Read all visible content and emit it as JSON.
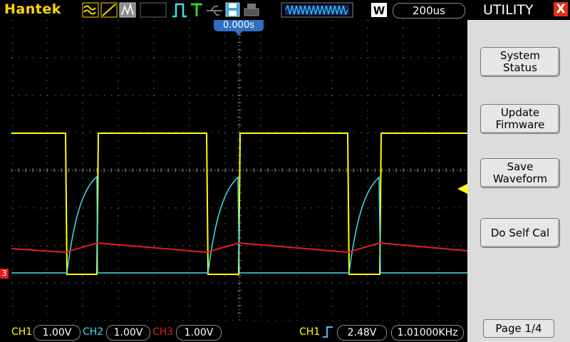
{
  "topbar": {
    "brand": "Hantek",
    "timebase": "200us",
    "icons": [
      "waveform-mode-icons",
      "run-icon",
      "trigger-icon",
      "usb-icon",
      "save-icon",
      "print-icon",
      "memory-depth-icon",
      "w-icon"
    ]
  },
  "trigger_time": "0.000s",
  "sidebar": {
    "title": "UTILITY",
    "close_symbol": "X",
    "buttons": [
      "System\nStatus",
      "Update\nFirmware",
      "Save\nWaveform",
      "Do Self Cal"
    ],
    "page": "Page 1/4"
  },
  "bottombar": {
    "ch1_label": "CH1",
    "ch1_value": "1.00V",
    "ch2_label": "CH2",
    "ch2_value": "1.00V",
    "ch3_label": "CH3",
    "ch3_value": "1.00V",
    "trig_label": "CH1",
    "trig_level": "2.48V",
    "frequency": "1.01000KHz"
  },
  "channel_marker": "3",
  "colors": {
    "ch1": "#ffff00",
    "ch2": "#40e0f0",
    "ch3": "#e02020",
    "accent": "#3070c0"
  }
}
